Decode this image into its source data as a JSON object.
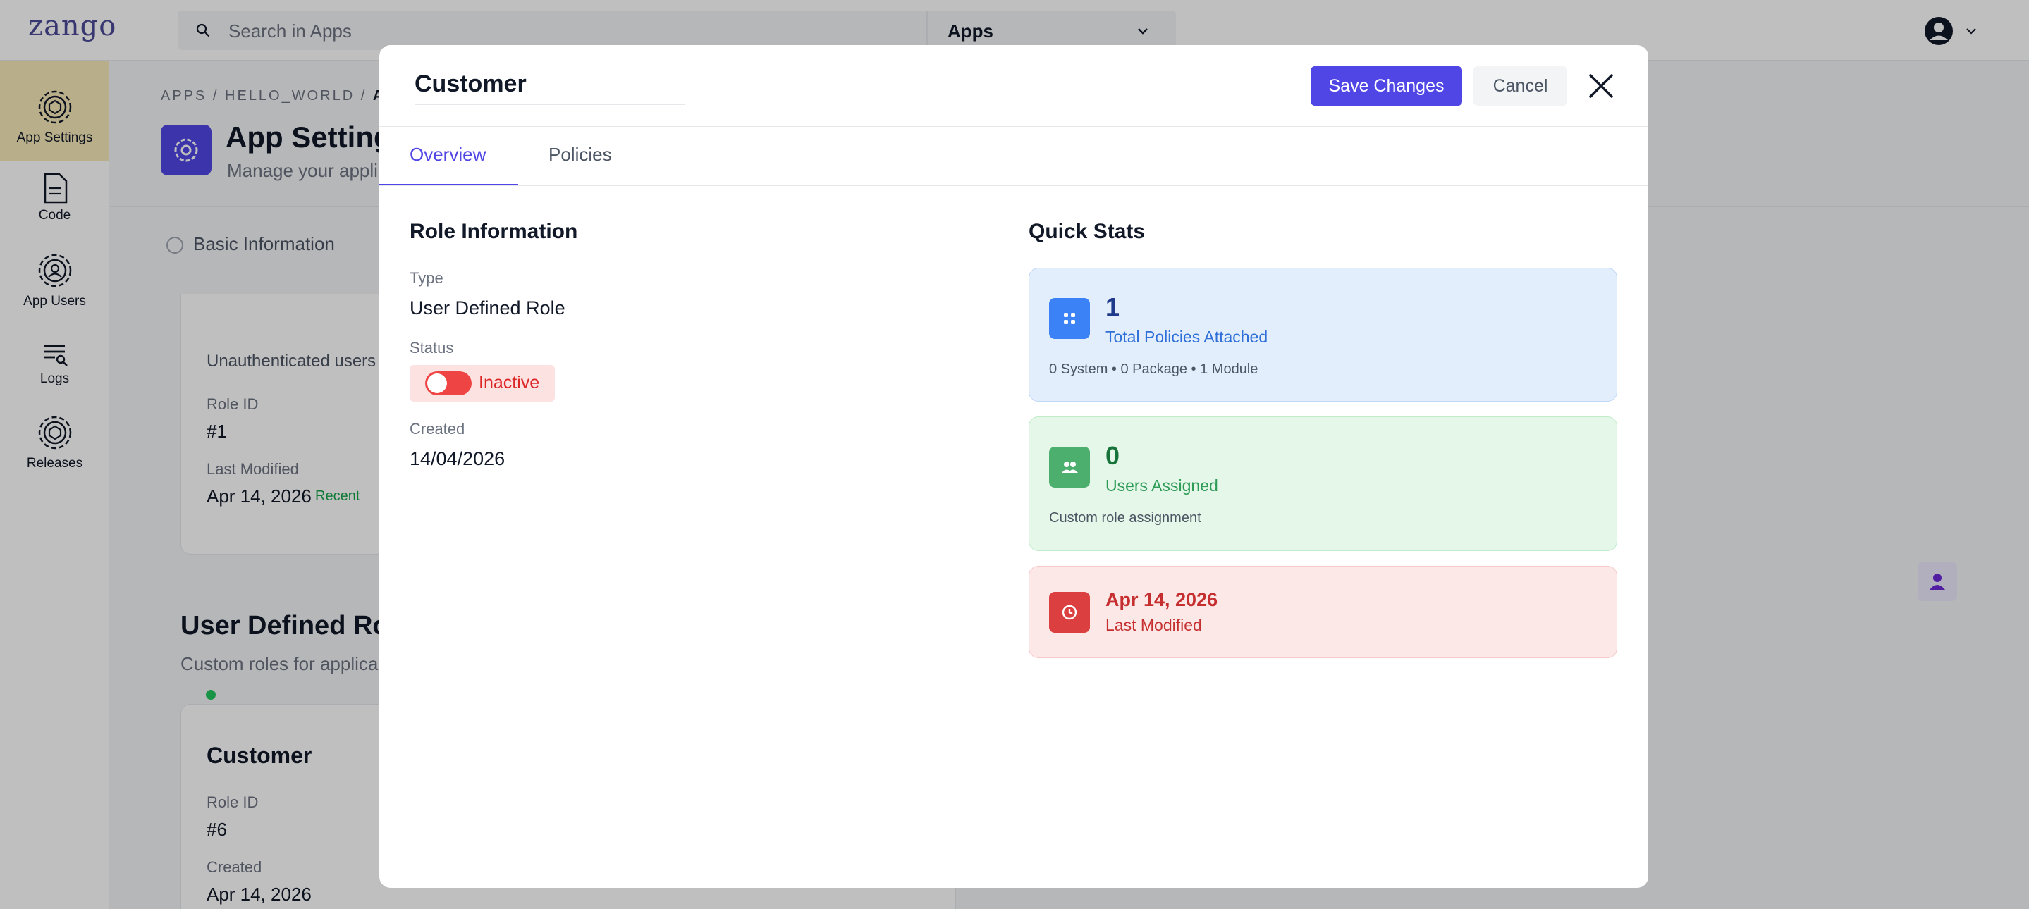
{
  "app": {
    "logo": "zango",
    "search_placeholder": "Search in Apps",
    "app_selector": "Apps"
  },
  "sidebar": {
    "items": [
      {
        "label": "App Settings"
      },
      {
        "label": "Code"
      },
      {
        "label": "App Users"
      },
      {
        "label": "Logs"
      },
      {
        "label": "Releases"
      }
    ]
  },
  "page": {
    "breadcrumb_start": "APPS / HELLO_WORLD / ",
    "breadcrumb_end": "AP",
    "title": "App Settings",
    "subtitle": "Manage your applic",
    "tab_basic": "Basic Information",
    "card1": {
      "text": "Unauthenticated users",
      "role_id_label": "Role ID",
      "role_id": "#1",
      "modified_label": "Last Modified",
      "modified": "Apr 14, 2026",
      "recent": "Recent"
    },
    "section_title": "User Defined Role",
    "section_sub": "Custom roles for applica",
    "card2": {
      "title": "Customer",
      "role_id_label": "Role ID",
      "role_id": "#6",
      "created_label": "Created",
      "created": "Apr 14, 2026"
    }
  },
  "modal": {
    "title": "Customer",
    "save_label": "Save Changes",
    "cancel_label": "Cancel",
    "tabs": [
      {
        "label": "Overview"
      },
      {
        "label": "Policies"
      }
    ],
    "role_info": {
      "heading": "Role Information",
      "type_label": "Type",
      "type_value": "User Defined Role",
      "status_label": "Status",
      "status_value": "Inactive",
      "created_label": "Created",
      "created_value": "14/04/2026"
    },
    "quick_stats": {
      "heading": "Quick Stats",
      "policies": {
        "value": "1",
        "label": "Total Policies Attached",
        "breakdown": "0 System • 0 Package • 1 Module"
      },
      "users": {
        "value": "0",
        "label": "Users Assigned",
        "desc": "Custom role assignment"
      },
      "modified": {
        "value": "Apr 14, 2026",
        "label": "Last Modified"
      }
    }
  },
  "colors": {
    "accent": "#4f46e5",
    "inactive": "#ef4444",
    "blue_card": "#3b82f6",
    "green_card": "#4caf6e",
    "red_card": "#dc3f3f"
  }
}
